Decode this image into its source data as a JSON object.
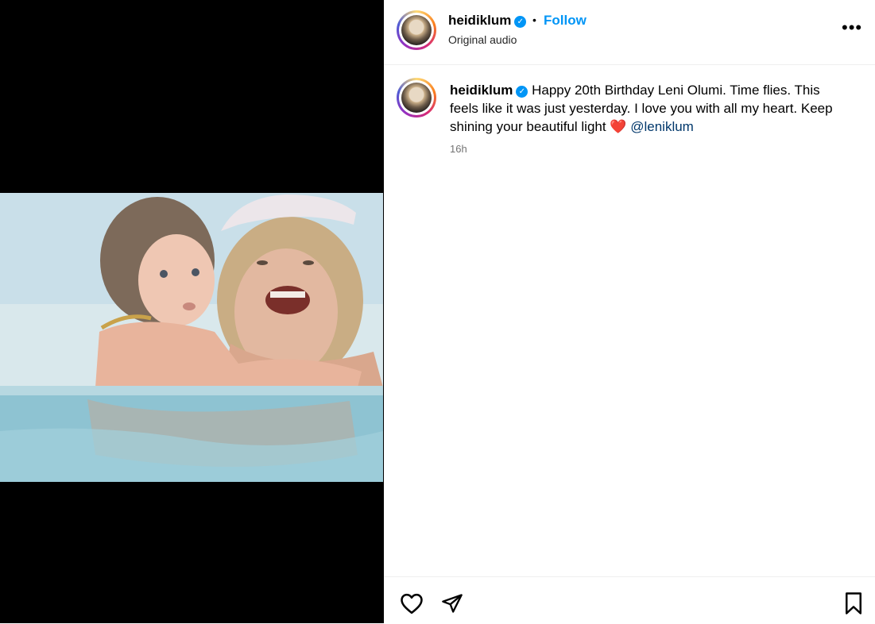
{
  "post": {
    "username": "heidiklum",
    "verified": true,
    "dot": "•",
    "follow_label": "Follow",
    "audio_label": "Original audio",
    "more_label": "•••"
  },
  "caption": {
    "username": "heidiklum",
    "text": "Happy 20th Birthday Leni Olumi. Time flies. This feels like it was just yesterday. I love you with all my heart. Keep shining your beautiful light",
    "emoji": "❤️",
    "mention": "@leniklum",
    "time": "16h"
  },
  "actions": {
    "like": "heart-icon",
    "share": "send-icon",
    "save": "bookmark-icon"
  },
  "colors": {
    "accent": "#0095f6",
    "mention": "#00376b",
    "muted": "#737373"
  }
}
